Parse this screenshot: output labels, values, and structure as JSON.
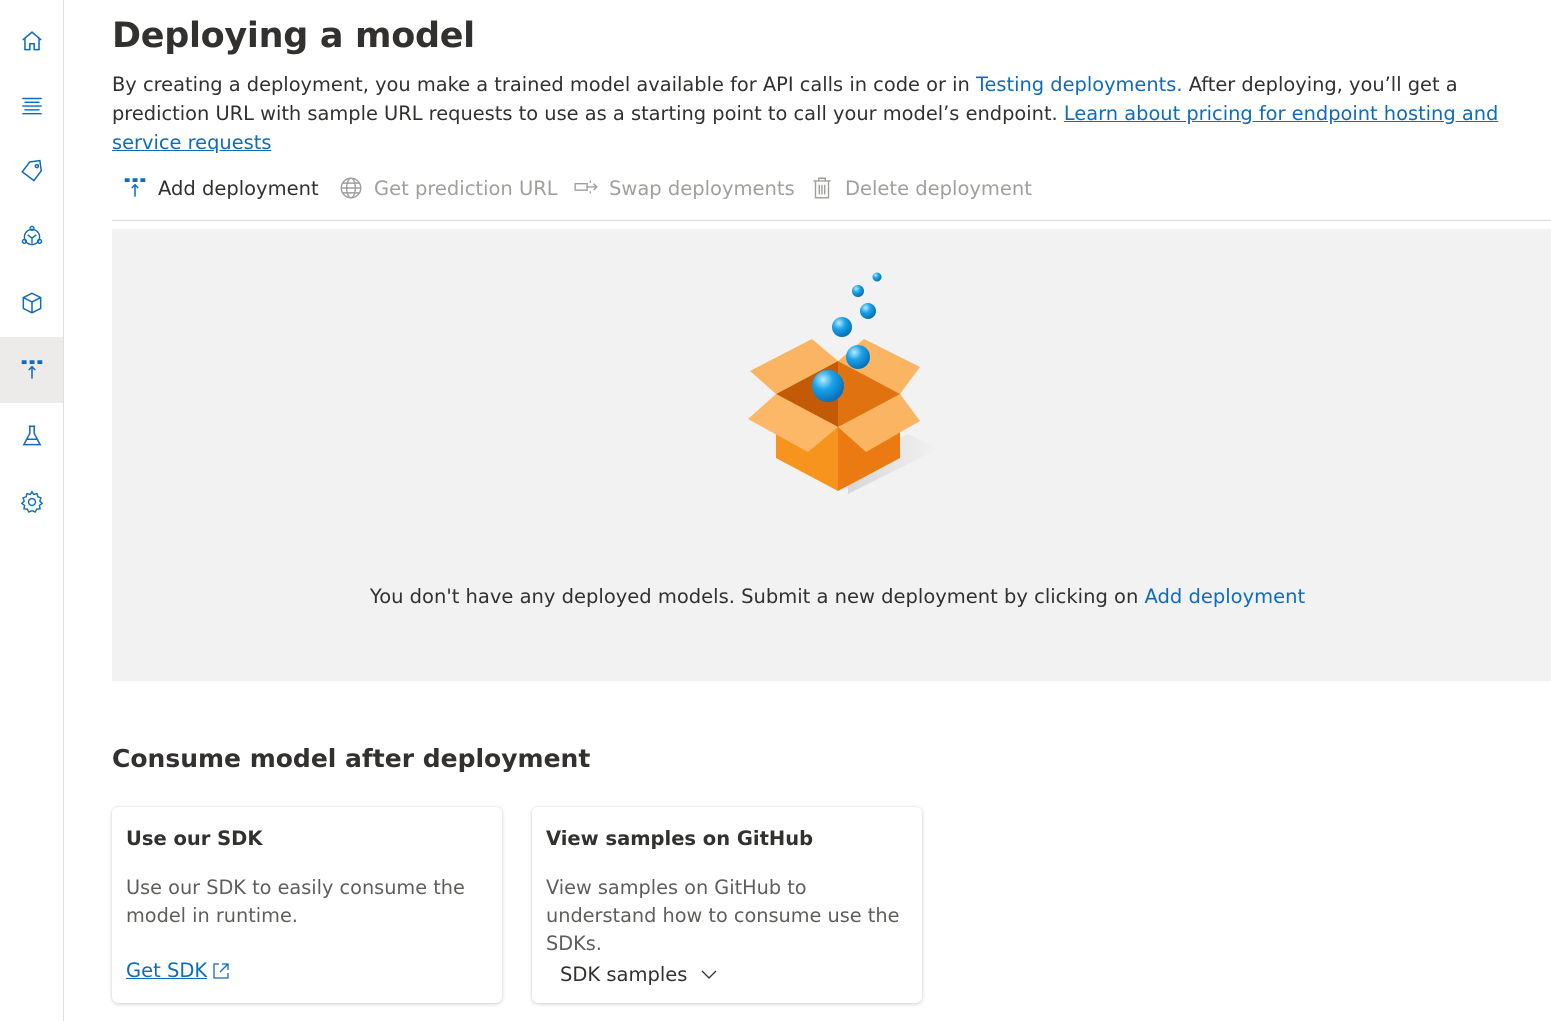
{
  "nav_rail": {
    "items": [
      {
        "name": "home-icon",
        "active": false
      },
      {
        "name": "list-icon",
        "active": false
      },
      {
        "name": "tag-icon",
        "active": false
      },
      {
        "name": "training-icon",
        "active": false
      },
      {
        "name": "model-icon",
        "active": false
      },
      {
        "name": "deploy-icon",
        "active": true
      },
      {
        "name": "test-flask-icon",
        "active": false
      },
      {
        "name": "settings-icon",
        "active": false
      }
    ]
  },
  "page": {
    "title": "Deploying a model",
    "intro_part1": "By creating a deployment, you make a trained model available for API calls in code or in ",
    "intro_link1": "Testing deployments.",
    "intro_part2": " After deploying, you’ll get a prediction URL with sample URL requests to use as a starting point to call your model’s endpoint. ",
    "intro_link2": "Learn about pricing for endpoint hosting and service requests"
  },
  "toolbar": {
    "add_deployment": "Add deployment",
    "get_prediction_url": "Get prediction URL",
    "swap_deployments": "Swap deployments",
    "delete_deployment": "Delete deployment"
  },
  "empty_state": {
    "message": "You don't have any deployed models. Submit a new deployment by clicking on ",
    "link": "Add deployment"
  },
  "consume": {
    "section_title": "Consume model after deployment",
    "cards": [
      {
        "title": "Use our SDK",
        "description": "Use our SDK to easily consume the model in runtime.",
        "action": "Get SDK"
      },
      {
        "title": "View samples on GitHub",
        "description": "View samples on GitHub to understand how to consume use the SDKs.",
        "action": "SDK samples"
      }
    ]
  },
  "colors": {
    "accent": "#0f6cbd",
    "text": "#323130",
    "muted": "#a19f9d",
    "panel_bg": "#f2f2f2",
    "box_orange": "#f7941d",
    "sphere_blue": "#1aa3e8"
  }
}
